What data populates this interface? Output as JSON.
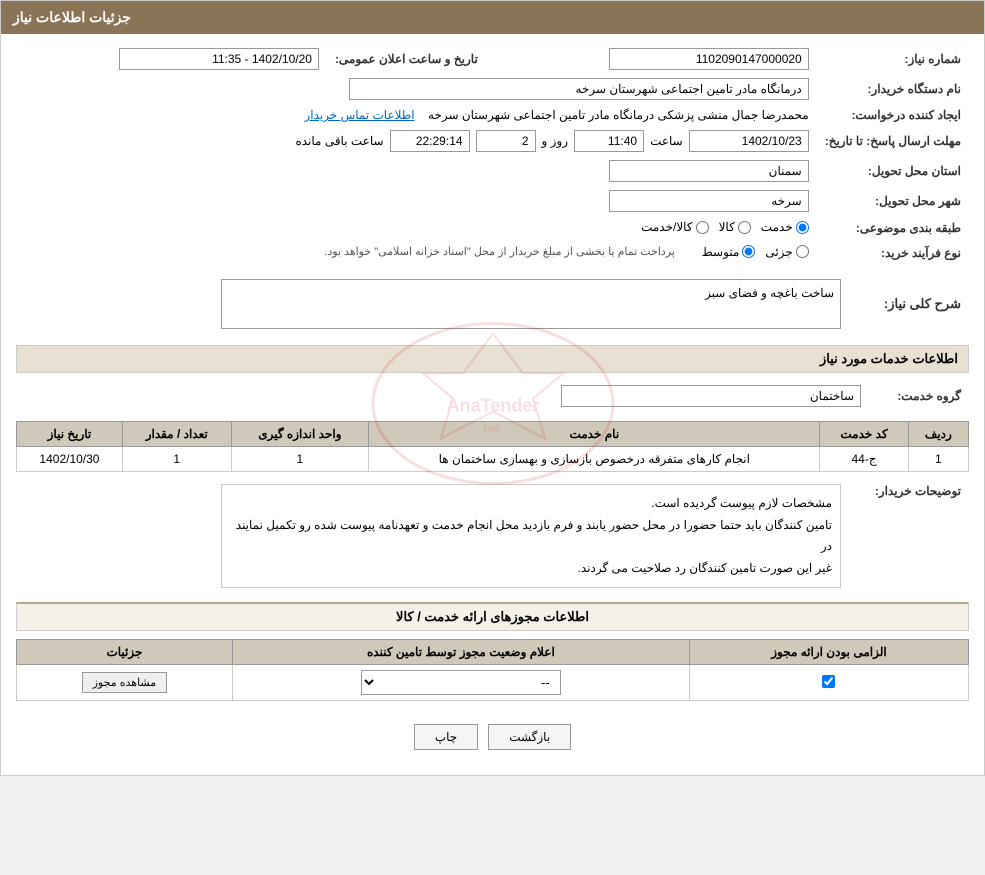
{
  "page": {
    "title": "جزئیات اطلاعات نیاز"
  },
  "header": {
    "announcement_label": "تاریخ و ساعت اعلان عمومی:",
    "announcement_value": "1402/10/20 - 11:35",
    "need_number_label": "شماره نیاز:",
    "need_number_value": "1102090147000020",
    "buyer_org_label": "نام دستگاه خریدار:",
    "buyer_org_value": "درمانگاه مادر تامین اجتماعی شهرستان سرخه",
    "creator_label": "ایجاد کننده درخواست:",
    "creator_value": "محمدرضا جمال منشی پزشکی درمانگاه مادر تامین اجتماعی شهرستان سرخه",
    "contact_link": "اطلاعات تماس خریدار",
    "deadline_label": "مهلت ارسال پاسخ: تا تاریخ:",
    "deadline_date": "1402/10/23",
    "deadline_time_label": "ساعت",
    "deadline_time": "11:40",
    "deadline_day_label": "روز و",
    "deadline_days": "2",
    "deadline_remaining_label": "ساعت باقی مانده",
    "deadline_remaining": "22:29:14",
    "province_label": "استان محل تحویل:",
    "province_value": "سمنان",
    "city_label": "شهر محل تحویل:",
    "city_value": "سرخه",
    "category_label": "طبقه بندی موضوعی:",
    "category_options": [
      "کالا",
      "خدمت",
      "کالا/خدمت"
    ],
    "category_selected": "خدمت",
    "purchase_type_label": "نوع فرآیند خرید:",
    "purchase_type_note": "پرداخت تمام یا بخشی از مبلغ خریدار از محل \"اسناد خزانه اسلامی\" خواهد بود.",
    "purchase_type_options": [
      "جزئی",
      "متوسط"
    ],
    "purchase_type_selected": "متوسط"
  },
  "need_description": {
    "section_title": "شرح کلی نیاز:",
    "value": "ساخت باغچه و فضای سبز"
  },
  "services_section": {
    "title": "اطلاعات خدمات مورد نیاز",
    "service_group_label": "گروه خدمت:",
    "service_group_value": "ساختمان",
    "table_headers": [
      "ردیف",
      "کد خدمت",
      "نام خدمت",
      "واحد اندازه گیری",
      "تعداد / مقدار",
      "تاریخ نیاز"
    ],
    "table_rows": [
      {
        "row": "1",
        "code": "ج-44",
        "name": "انجام کارهای متفرقه درخصوص بازسازی و بهسازی ساختمان ها",
        "unit": "1",
        "qty": "1",
        "date": "1402/10/30"
      }
    ]
  },
  "buyer_notes": {
    "label": "توضیحات خریدار:",
    "lines": [
      "مشخصات لازم پیوست گردیده است.",
      "تامین کنندگان باید حتما حضورا در محل حضور یابند و فرم بازدید محل انجام خدمت و تعهدنامه پیوست شده رو تکمیل نمایند در",
      "غیر این صورت تامین کنندگان رد صلاحیت می گردند."
    ]
  },
  "permit_section": {
    "title": "اطلاعات مجوزهای ارائه خدمت / کالا",
    "table_headers": [
      "الزامی بودن ارائه مجوز",
      "اعلام وضعیت مجوز توسط تامین کننده",
      "جزئیات"
    ],
    "rows": [
      {
        "required": true,
        "status": "--",
        "details_btn": "مشاهده مجوز"
      }
    ]
  },
  "buttons": {
    "print": "چاپ",
    "back": "بازگشت"
  }
}
